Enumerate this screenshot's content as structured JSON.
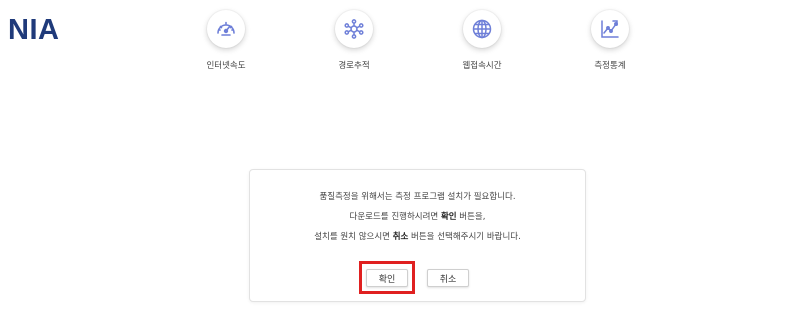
{
  "brand": {
    "logo": "NIA"
  },
  "nav": [
    {
      "label": "인터넷속도",
      "icon": "speedometer-icon"
    },
    {
      "label": "경로추적",
      "icon": "route-network-icon"
    },
    {
      "label": "웹접속시간",
      "icon": "globe-icon"
    },
    {
      "label": "측정통계",
      "icon": "statistics-chart-icon"
    }
  ],
  "dialog": {
    "line1": "품질측정을 위해서는 측정 프로그램 설치가 필요합니다.",
    "line2_pre": "다운로드를 진행하시려면 ",
    "line2_bold": "확인",
    "line2_post": " 버튼을,",
    "line3_pre": "설치를 원치 않으시면 ",
    "line3_bold": "취소",
    "line3_post": " 버튼을 선택해주시기 바랍니다.",
    "confirm_label": "확인",
    "cancel_label": "취소"
  },
  "colors": {
    "brand": "#1f3a7a",
    "icon": "#6e7fd8",
    "highlight": "#e02020"
  }
}
